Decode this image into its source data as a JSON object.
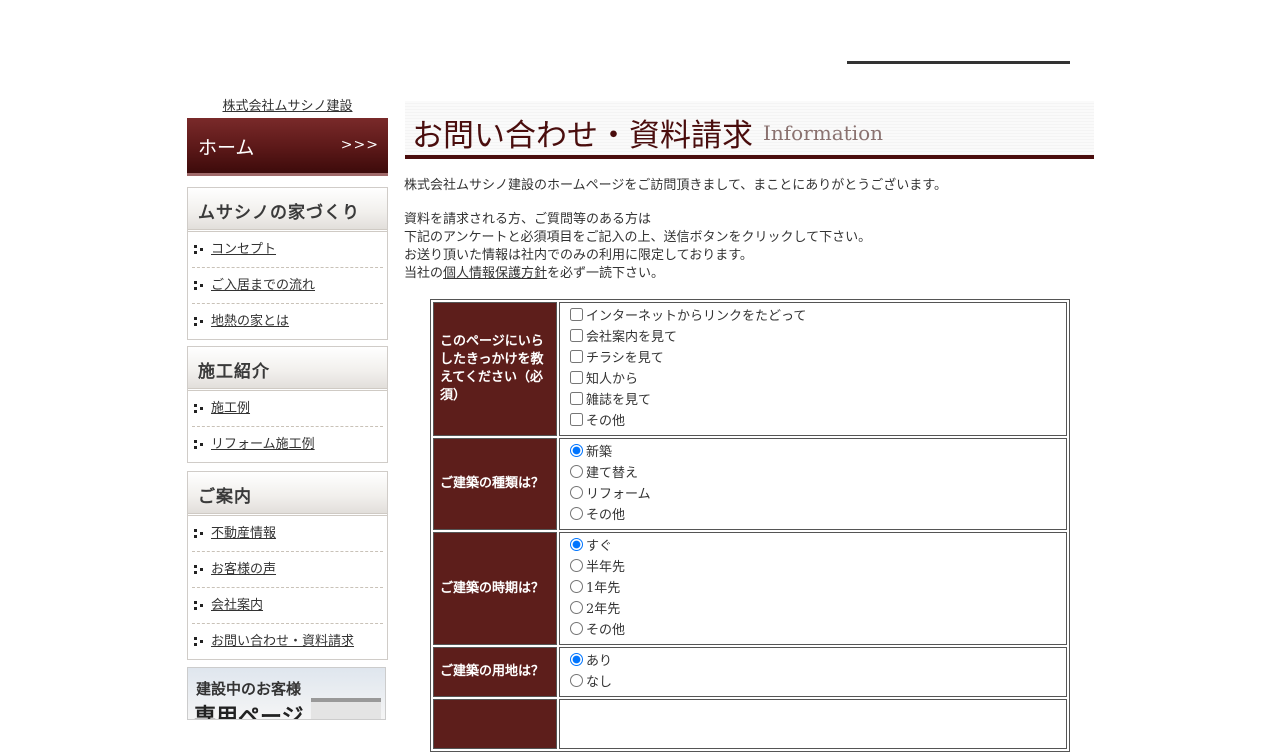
{
  "company_name": "株式会社ムサシノ建設",
  "sidebar": {
    "home": {
      "label": "ホーム",
      "arrow": ">>>"
    },
    "sections": [
      {
        "title": "ムサシノの家づくり",
        "items": [
          "コンセプト",
          "ご入居までの流れ",
          "地熱の家とは"
        ]
      },
      {
        "title": "施工紹介",
        "items": [
          "施工例",
          "リフォーム施工例"
        ]
      },
      {
        "title": "ご案内",
        "items": [
          "不動産情報",
          "お客様の声",
          "会社案内",
          "お問い合わせ・資料請求"
        ]
      }
    ],
    "banner": {
      "line1": "建設中のお客様",
      "line2": "専用ページ"
    }
  },
  "page_title": {
    "jp": "お問い合わせ・資料請求",
    "en": "Information"
  },
  "intro": {
    "line1": "株式会社ムサシノ建設のホームページをご訪問頂きまして、まことにありがとうございます。",
    "line2": "資料を請求される方、ご質問等のある方は",
    "line3": "下記のアンケートと必須項目をご記入の上、送信ボタンをクリックして下さい。",
    "line4": "お送り頂いた情報は社内でのみの利用に限定しております。",
    "line5_pre": "当社の",
    "line5_link": "個人情報保護方針",
    "line5_post": "を必ず一読下さい。"
  },
  "form": {
    "q1": {
      "label": "このページにいらしたきっかけを教えてください（必須）",
      "options": [
        "インターネットからリンクをたどって",
        "会社案内を見て",
        "チラシを見て",
        "知人から",
        "雑誌を見て",
        "その他"
      ]
    },
    "q2": {
      "label": "ご建築の種類は？",
      "options": [
        "新築",
        "建て替え",
        "リフォーム",
        "その他"
      ],
      "selected": "新築"
    },
    "q3": {
      "label": "ご建築の時期は？",
      "options": [
        "すぐ",
        "半年先",
        "1年先",
        "2年先",
        "その他"
      ],
      "selected": "すぐ"
    },
    "q4": {
      "label": "ご建築の用地は？",
      "options": [
        "あり",
        "なし"
      ],
      "selected": "あり"
    }
  }
}
